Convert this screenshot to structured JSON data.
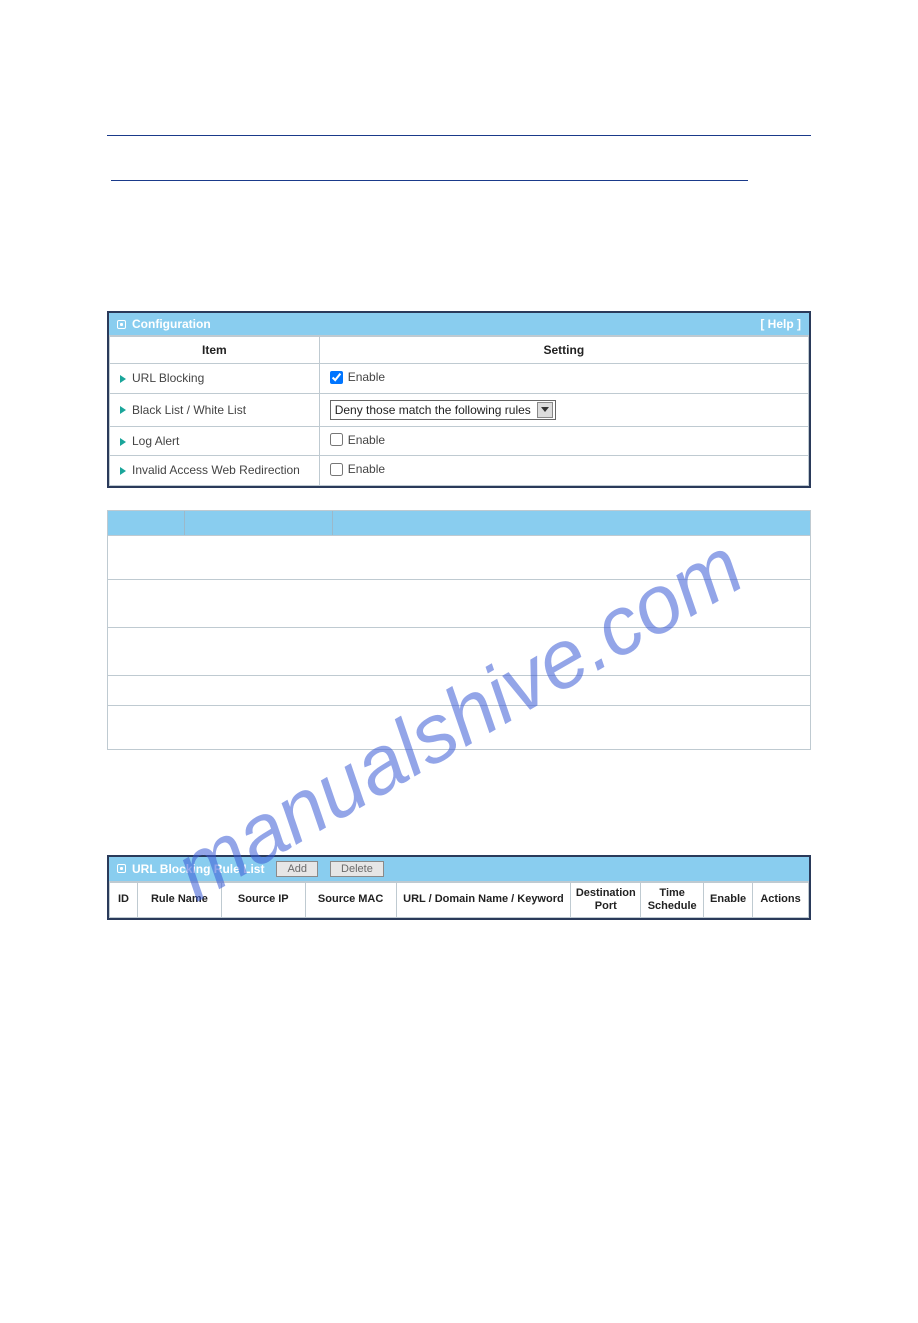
{
  "watermark_text": "manualshive.com",
  "configuration": {
    "header_label": "Configuration",
    "help_label": "[ Help ]",
    "columns": {
      "item": "Item",
      "setting": "Setting"
    },
    "rows": {
      "url_blocking": {
        "label": "URL Blocking",
        "enable_label": "Enable",
        "enabled": true
      },
      "black_white_list": {
        "label": "Black List / White List",
        "selected_option": "Deny those match the following rules"
      },
      "log_alert": {
        "label": "Log Alert",
        "enable_label": "Enable",
        "enabled": false
      },
      "invalid_redirect": {
        "label": "Invalid Access Web Redirection",
        "enable_label": "Enable",
        "enabled": false
      }
    }
  },
  "rule_list": {
    "header_label": "URL Blocking Rule List",
    "add_label": "Add",
    "delete_label": "Delete",
    "columns": {
      "id": "ID",
      "rule_name": "Rule Name",
      "source_ip": "Source IP",
      "source_mac": "Source MAC",
      "url_domain_keyword": "URL / Domain Name / Keyword",
      "dest_port": "Destination Port",
      "time_schedule": "Time Schedule",
      "enable": "Enable",
      "actions": "Actions"
    }
  }
}
